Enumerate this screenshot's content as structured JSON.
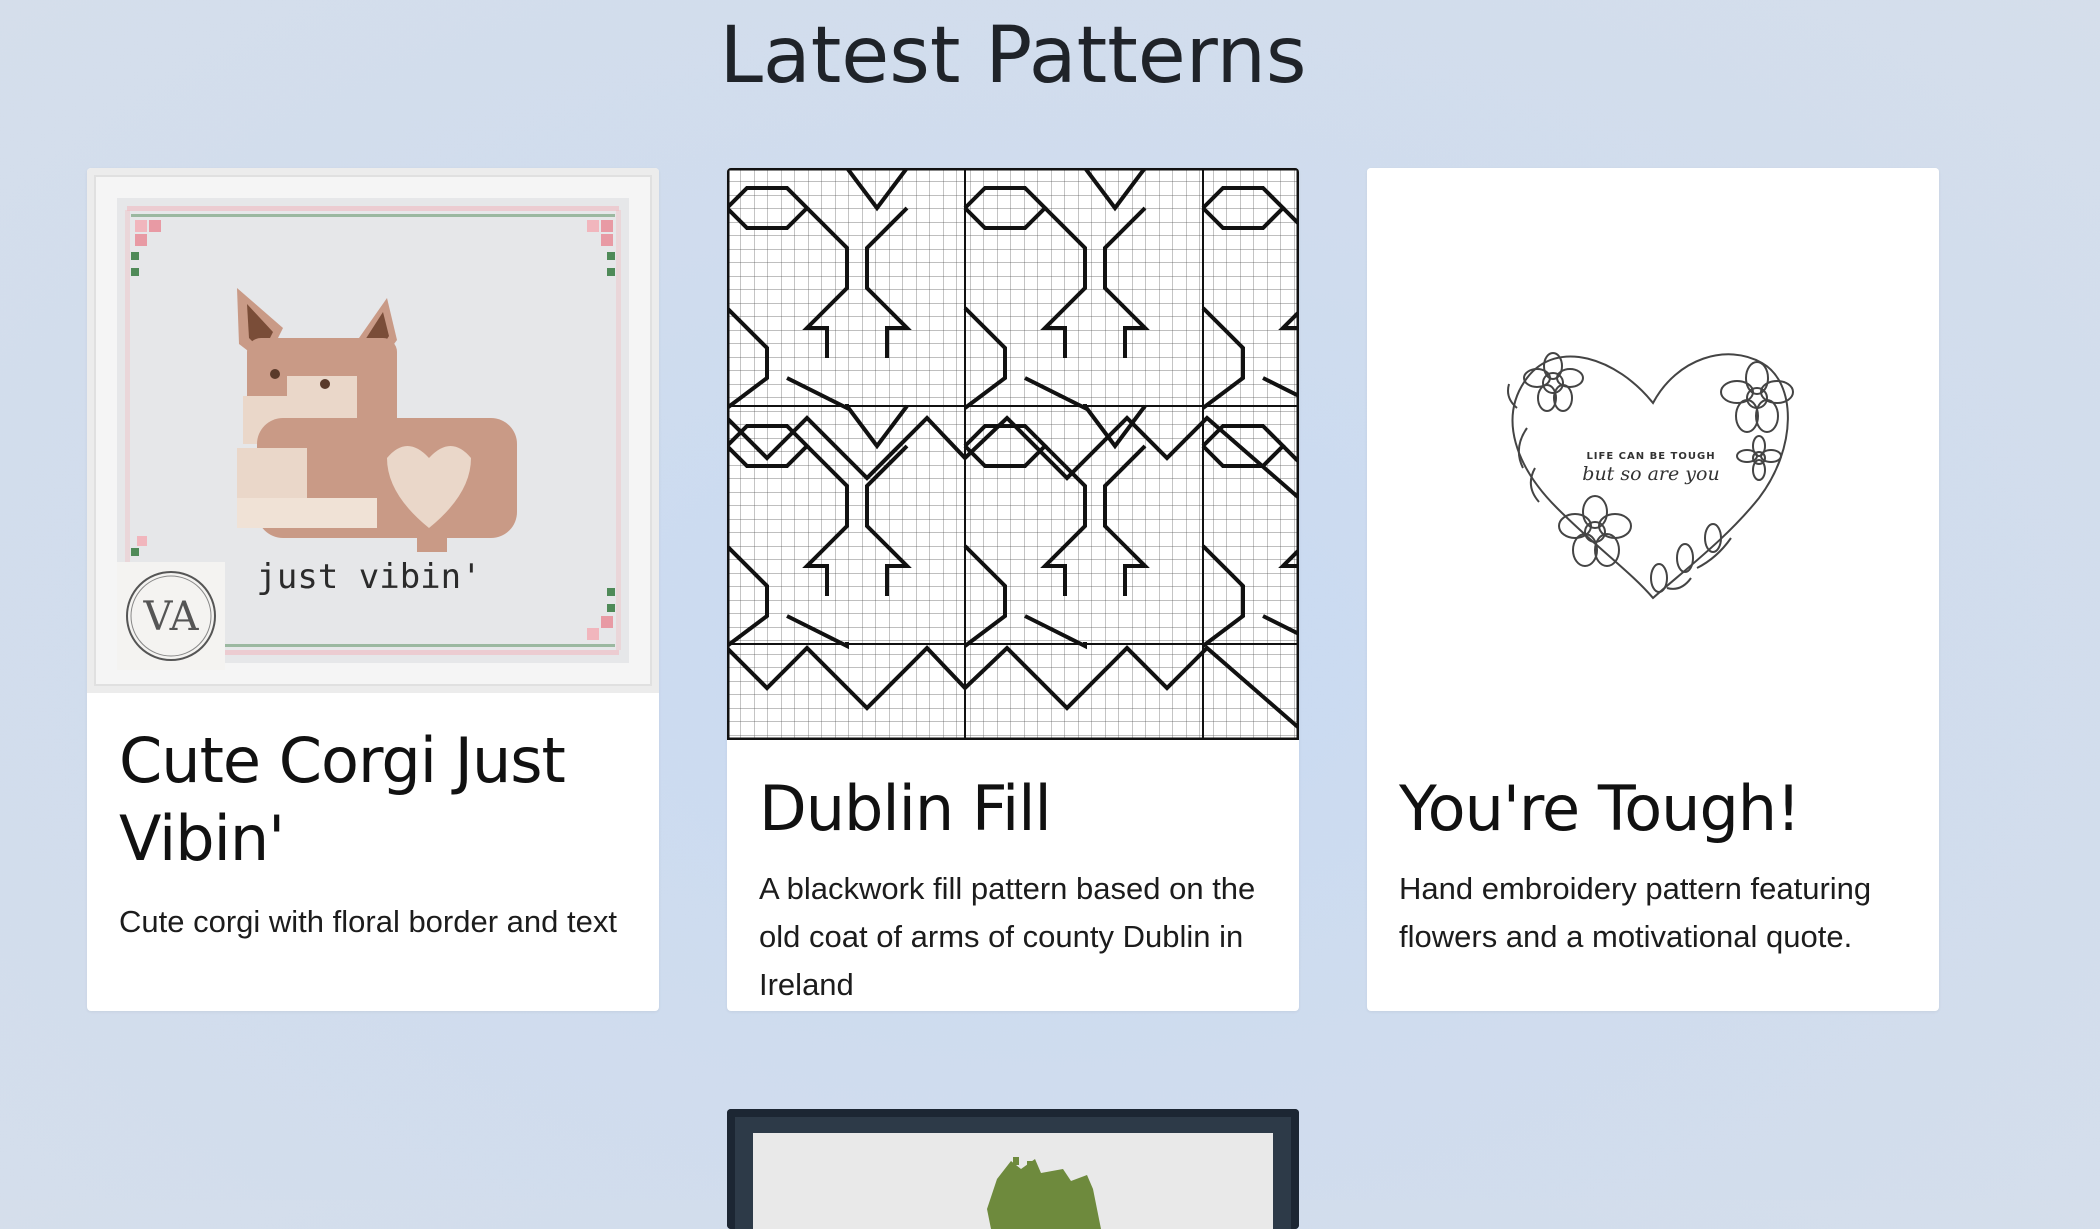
{
  "page": {
    "title": "Latest Patterns"
  },
  "cards": [
    {
      "title": "Cute Corgi Just Vibin'",
      "description": "Cute corgi with floral border and text",
      "image_text": "just vibin'",
      "logo_text": "VA"
    },
    {
      "title": "Dublin Fill",
      "description": "A blackwork fill pattern based on the old coat of arms of county Dublin in Ireland"
    },
    {
      "title": "You're Tough!",
      "description": "Hand embroidery pattern featuring flowers and a motivational quote.",
      "image_text_small": "LIFE CAN BE TOUGH",
      "image_text_script": "but so are you"
    }
  ],
  "colors": {
    "background": "#cbdaf0",
    "card": "#ffffff",
    "title": "#1f2329",
    "corgi_body": "#c99a86",
    "corgi_light": "#ead7c9",
    "flower_pink": "#f1b6bd",
    "leaf_green": "#4f8a58",
    "map_green": "#6e8a3d"
  }
}
